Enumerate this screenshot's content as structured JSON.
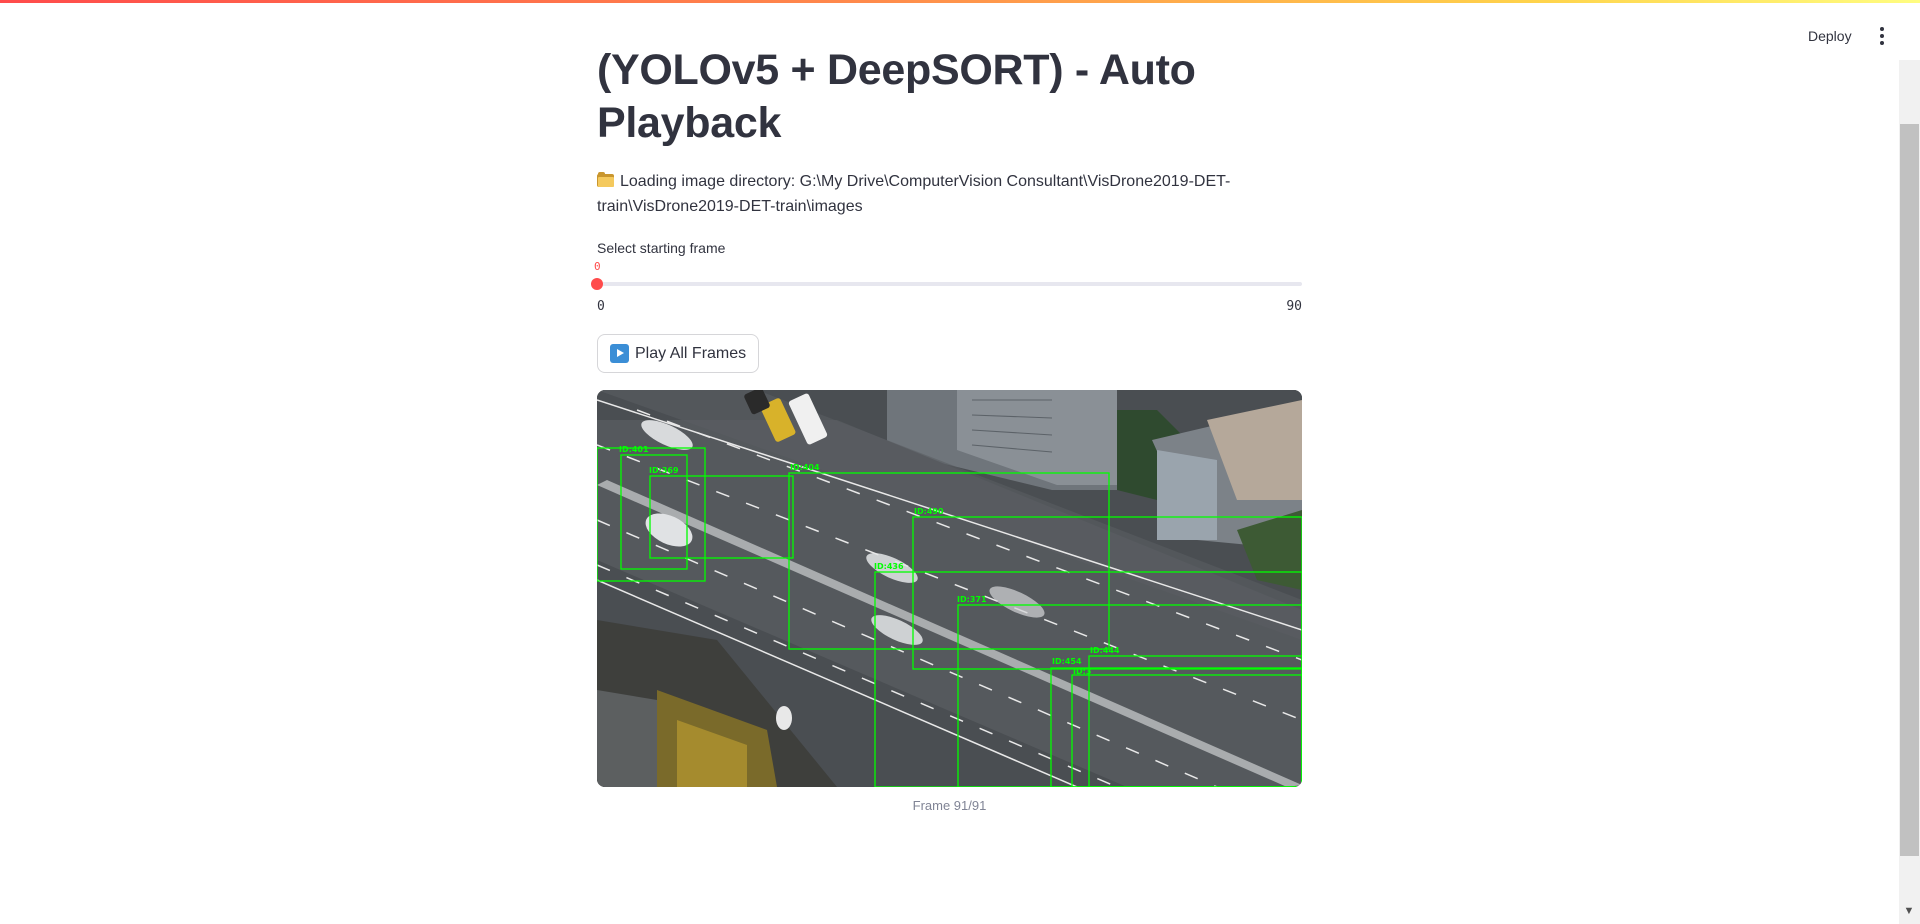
{
  "header": {
    "deploy_label": "Deploy",
    "menu_icon": "vertical-ellipsis-icon"
  },
  "main": {
    "title": "(YOLOv5 + DeepSORT) - Auto Playback",
    "directory_message": "Loading image directory: G:\\My Drive\\ComputerVision Consultant\\VisDrone2019-DET-train\\VisDrone2019-DET-train\\images",
    "directory_icon": "folder-icon"
  },
  "slider": {
    "label": "Select starting frame",
    "value": 0,
    "min": 0,
    "max": 90,
    "value_text": "0",
    "min_text": "0",
    "max_text": "90"
  },
  "play_button": {
    "label": "Play All Frames",
    "icon": "play-icon"
  },
  "video": {
    "caption": "Frame 91/91",
    "box_color": "#00ff00",
    "track_ids": [
      "ID:401",
      "ID:369",
      "ID:404",
      "ID:490",
      "ID:436",
      "ID:371",
      "ID:454",
      "ID:444",
      "ID:3"
    ]
  },
  "colors": {
    "accent": "#ff4b4b",
    "text": "#31333f",
    "caption": "#808495"
  }
}
